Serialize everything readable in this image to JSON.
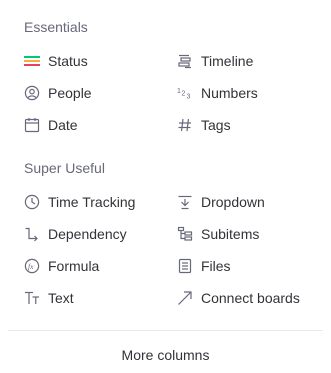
{
  "essentials": {
    "title": "Essentials",
    "items": [
      {
        "label": "Status",
        "icon": "status-icon"
      },
      {
        "label": "Timeline",
        "icon": "timeline-icon"
      },
      {
        "label": "People",
        "icon": "people-icon"
      },
      {
        "label": "Numbers",
        "icon": "numbers-icon"
      },
      {
        "label": "Date",
        "icon": "date-icon"
      },
      {
        "label": "Tags",
        "icon": "tags-icon"
      }
    ]
  },
  "super_useful": {
    "title": "Super Useful",
    "items": [
      {
        "label": "Time Tracking",
        "icon": "time-tracking-icon"
      },
      {
        "label": "Dropdown",
        "icon": "dropdown-icon"
      },
      {
        "label": "Dependency",
        "icon": "dependency-icon"
      },
      {
        "label": "Subitems",
        "icon": "subitems-icon"
      },
      {
        "label": "Formula",
        "icon": "formula-icon"
      },
      {
        "label": "Files",
        "icon": "files-icon"
      },
      {
        "label": "Text",
        "icon": "text-icon"
      },
      {
        "label": "Connect boards",
        "icon": "connect-boards-icon"
      }
    ]
  },
  "footer": {
    "more_label": "More columns"
  },
  "colors": {
    "status_green": "#00c875",
    "status_orange": "#fdab3d",
    "status_red": "#e2445c",
    "icon_gray": "#676879",
    "divider": "#e6e9ef"
  }
}
